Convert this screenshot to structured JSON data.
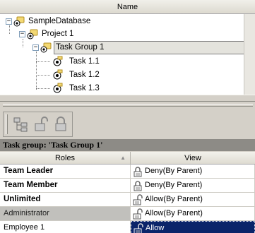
{
  "tree": {
    "header": "Name",
    "nodes": [
      {
        "label": "SampleDatabase",
        "expander": "−"
      },
      {
        "label": "Project 1",
        "expander": "−"
      },
      {
        "label": "Task Group 1",
        "expander": "−",
        "selected": true
      },
      {
        "label": "Task 1.1"
      },
      {
        "label": "Task 1.2"
      },
      {
        "label": "Task 1.3"
      }
    ]
  },
  "toolbar": {
    "buttons": [
      "hierarchy-icon",
      "unlock-icon",
      "lock-icon"
    ]
  },
  "caption": "Task group: 'Task Group 1'",
  "grid": {
    "headers": {
      "roles": "Roles",
      "view": "View"
    },
    "rows": [
      {
        "role": "Team Leader",
        "bold": true,
        "view": "Deny(By Parent)",
        "lock": "locked"
      },
      {
        "role": "Team Member",
        "bold": true,
        "view": "Deny(By Parent)",
        "lock": "locked"
      },
      {
        "role": "Unlimited",
        "bold": true,
        "view": "Allow(By Parent)",
        "lock": "unlocked"
      },
      {
        "role": "Administrator",
        "bold": false,
        "view": "Allow(By Parent)",
        "lock": "unlocked",
        "row_selected": true
      },
      {
        "role": "Employee 1",
        "bold": false,
        "view": "Allow",
        "lock": "unlocked",
        "cell_selected": true
      }
    ]
  },
  "colors": {
    "caption_bg": "#8d8b86",
    "selected_row_bg": "#c1c0bc",
    "selected_cell_bg": "#0a246a"
  }
}
